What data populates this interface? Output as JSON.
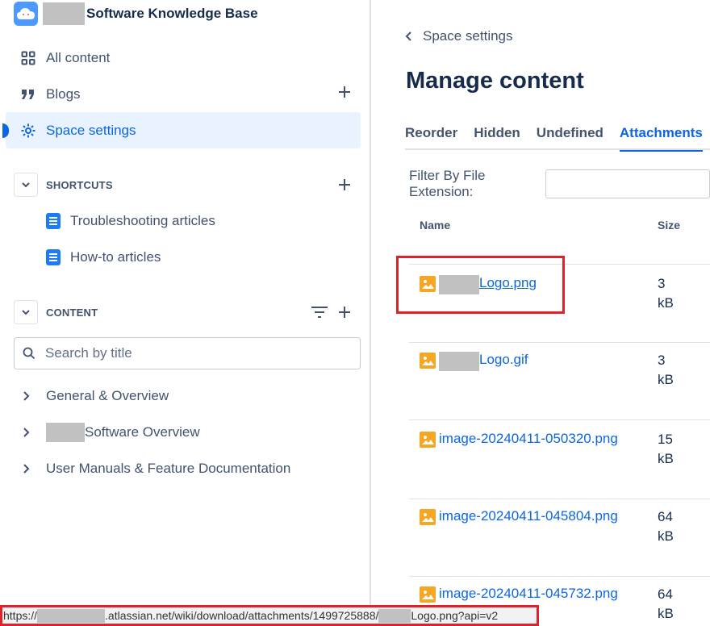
{
  "space": {
    "name": "Software Knowledge Base"
  },
  "nav": {
    "all_content": "All content",
    "blogs": "Blogs",
    "space_settings": "Space settings"
  },
  "shortcuts": {
    "title": "SHORTCUTS",
    "items": [
      "Troubleshooting articles",
      "How-to articles"
    ]
  },
  "content": {
    "title": "CONTENT",
    "search_placeholder": "Search by title",
    "tree": [
      "General & Overview",
      "Software Overview",
      "User Manuals & Feature Documentation"
    ]
  },
  "status_bar": {
    "prefix": "https://",
    "middle": ".atlassian.net/wiki/download/attachments/1499725888/",
    "suffix": "Logo.png?api=v2"
  },
  "main": {
    "back_label": "Space settings",
    "title": "Manage content",
    "tabs": [
      "Reorder",
      "Hidden",
      "Undefined",
      "Attachments"
    ],
    "active_tab": "Attachments",
    "filter_label": "Filter By File Extension:",
    "columns": {
      "name": "Name",
      "size": "Size"
    },
    "attachments": [
      {
        "name": "Logo.png",
        "size": "3 kB"
      },
      {
        "name": "Logo.gif",
        "size": "3 kB"
      },
      {
        "name": "image-20240411-050320.png",
        "size": "15 kB"
      },
      {
        "name": "image-20240411-045804.png",
        "size": "64 kB"
      },
      {
        "name": "image-20240411-045732.png",
        "size": "64 kB"
      }
    ]
  },
  "colors": {
    "accent": "#0c66e4",
    "highlight": "#e0202a",
    "image_icon": "#f5a623"
  }
}
